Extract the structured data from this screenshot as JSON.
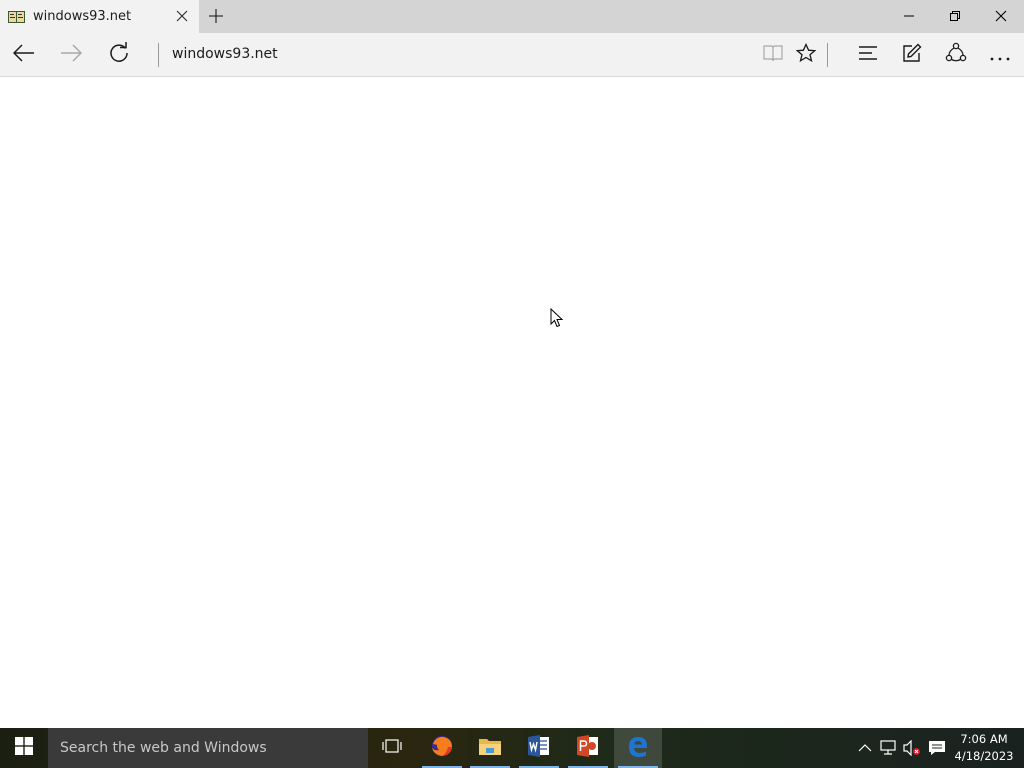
{
  "window": {
    "tab_title": "windows93.net",
    "minimize_icon": "minimize-icon",
    "restore_icon": "restore-icon",
    "close_icon": "close-icon"
  },
  "navbar": {
    "address": "windows93.net",
    "back_icon": "back-arrow-icon",
    "forward_icon": "forward-arrow-icon",
    "refresh_icon": "refresh-icon",
    "reading_view_icon": "reading-view-icon",
    "favorites_icon": "star-icon",
    "hub_icon": "hub-icon",
    "web_note_icon": "web-note-icon",
    "share_icon": "share-icon",
    "more_icon": "more-icon"
  },
  "taskbar": {
    "search_placeholder": "Search the web and Windows",
    "apps": [
      {
        "name": "task-view",
        "icon": "task-view-icon"
      },
      {
        "name": "firefox",
        "icon": "firefox-icon",
        "running": true
      },
      {
        "name": "file-explorer",
        "icon": "folder-icon",
        "running": true
      },
      {
        "name": "word",
        "icon": "word-icon",
        "running": true
      },
      {
        "name": "powerpoint",
        "icon": "powerpoint-icon",
        "running": true
      },
      {
        "name": "edge",
        "icon": "edge-icon",
        "running": true,
        "active": true
      }
    ],
    "clock": {
      "time": "7:06 AM",
      "date": "4/18/2023"
    }
  },
  "colors": {
    "titlebar": "#d4d4d4",
    "tab": "#f2f2f2",
    "taskbar_accent": "#7eb4ea",
    "edge_blue": "#1e74d0"
  }
}
